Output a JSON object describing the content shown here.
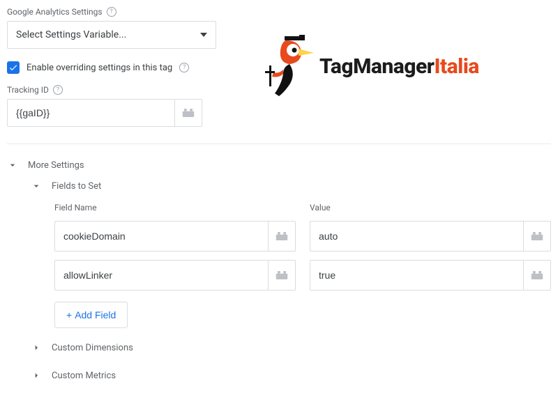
{
  "ga_settings_label": "Google Analytics Settings",
  "select_placeholder": "Select Settings Variable...",
  "override_label": "Enable overriding settings in this tag",
  "override_checked": true,
  "tracking_id_label": "Tracking ID",
  "tracking_id_value": "{{gaID}}",
  "more_settings_label": "More Settings",
  "fields_to_set_label": "Fields to Set",
  "field_name_header": "Field Name",
  "value_header": "Value",
  "fields": [
    {
      "name": "cookieDomain",
      "value": "auto"
    },
    {
      "name": "allowLinker",
      "value": "true"
    }
  ],
  "add_field_label": "Add Field",
  "custom_dimensions_label": "Custom Dimensions",
  "custom_metrics_label": "Custom Metrics",
  "brand": {
    "main": "TagManager",
    "accent": "Italia"
  }
}
